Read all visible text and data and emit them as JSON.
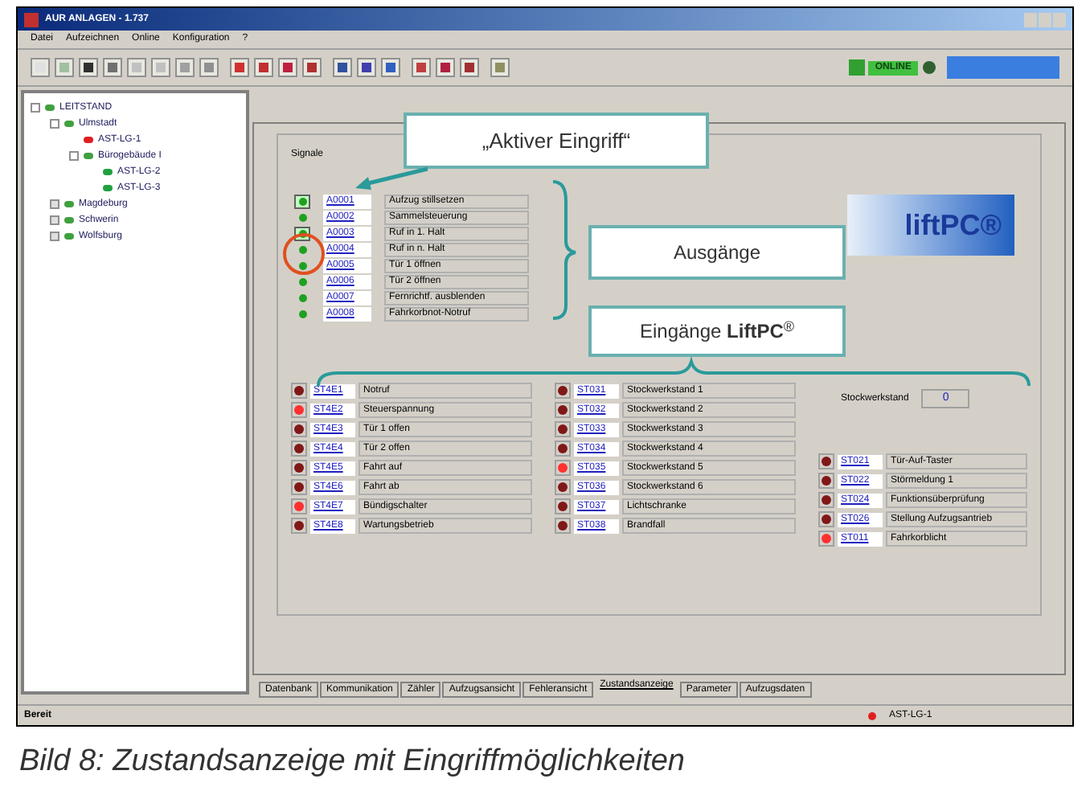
{
  "window": {
    "title": "AUR ANLAGEN - 1.737"
  },
  "menu": [
    "Datei",
    "Aufzeichnen",
    "Online",
    "Konfiguration",
    "?"
  ],
  "toolbar": {
    "status_label": "ONLINE"
  },
  "tree": [
    {
      "label": "LEITSTAND",
      "expanded": true,
      "children": [
        {
          "label": "Ulmstadt",
          "expanded": true,
          "children": [
            {
              "label": "AST-LG-1",
              "color": "#e02020"
            },
            {
              "label": "Bürogebäude I",
              "expanded": true,
              "children": [
                {
                  "label": "AST-LG-2",
                  "color": "#20a040"
                },
                {
                  "label": "AST-LG-3",
                  "color": "#20a040"
                }
              ]
            }
          ]
        },
        {
          "label": "Magdeburg",
          "expanded": false
        },
        {
          "label": "Schwerin",
          "expanded": false
        },
        {
          "label": "Wolfsburg",
          "expanded": false
        }
      ]
    }
  ],
  "signals": {
    "title": "Signale",
    "logo_text": "liftPC®",
    "outputs": [
      {
        "code": "A0001",
        "label": "Aufzug stillsetzen",
        "forced": true,
        "active": true
      },
      {
        "code": "A0002",
        "label": "Sammelsteuerung",
        "forced": false,
        "active": true
      },
      {
        "code": "A0003",
        "label": "Ruf in 1. Halt",
        "forced": true,
        "active": true
      },
      {
        "code": "A0004",
        "label": "Ruf in n. Halt",
        "forced": false,
        "active": true
      },
      {
        "code": "A0005",
        "label": "Tür 1 öffnen",
        "forced": false,
        "active": true
      },
      {
        "code": "A0006",
        "label": "Tür 2 öffnen",
        "forced": false,
        "active": true
      },
      {
        "code": "A0007",
        "label": "Fernrichtf. ausblenden",
        "forced": false,
        "active": true
      },
      {
        "code": "A0008",
        "label": "Fahrkorbnot-Notruf",
        "forced": false,
        "active": true
      }
    ],
    "input_columns": [
      [
        {
          "code": "ST4E1",
          "label": "Notruf",
          "active": false
        },
        {
          "code": "ST4E2",
          "label": "Steuerspannung",
          "active": true
        },
        {
          "code": "ST4E3",
          "label": "Tür 1 offen",
          "active": false
        },
        {
          "code": "ST4E4",
          "label": "Tür 2 offen",
          "active": false
        },
        {
          "code": "ST4E5",
          "label": "Fahrt auf",
          "active": false
        },
        {
          "code": "ST4E6",
          "label": "Fahrt ab",
          "active": false
        },
        {
          "code": "ST4E7",
          "label": "Bündigschalter",
          "active": true
        },
        {
          "code": "ST4E8",
          "label": "Wartungsbetrieb",
          "active": false
        }
      ],
      [
        {
          "code": "ST031",
          "label": "Stockwerkstand 1",
          "active": false
        },
        {
          "code": "ST032",
          "label": "Stockwerkstand 2",
          "active": false
        },
        {
          "code": "ST033",
          "label": "Stockwerkstand 3",
          "active": false
        },
        {
          "code": "ST034",
          "label": "Stockwerkstand 4",
          "active": false
        },
        {
          "code": "ST035",
          "label": "Stockwerkstand 5",
          "active": true
        },
        {
          "code": "ST036",
          "label": "Stockwerkstand 6",
          "active": false
        },
        {
          "code": "ST037",
          "label": "Lichtschranke",
          "active": false
        },
        {
          "code": "ST038",
          "label": "Brandfall",
          "active": false
        }
      ],
      [
        {
          "code": "ST021",
          "label": "Tür-Auf-Taster",
          "active": false
        },
        {
          "code": "ST022",
          "label": "Störmeldung 1",
          "active": false
        },
        {
          "code": "ST024",
          "label": "Funktionsüberprüfung",
          "active": false
        },
        {
          "code": "ST026",
          "label": "Stellung Aufzugsantrieb",
          "active": false
        },
        {
          "code": "ST011",
          "label": "Fahrkorblicht",
          "active": true
        }
      ]
    ],
    "floor": {
      "label": "Stockwerkstand",
      "value": "0"
    }
  },
  "tabs": [
    {
      "label": "Datenbank",
      "selected": false
    },
    {
      "label": "Kommunikation",
      "selected": false
    },
    {
      "label": "Zähler",
      "selected": false
    },
    {
      "label": "Aufzugsansicht",
      "selected": false
    },
    {
      "label": "Fehleransicht",
      "selected": false
    },
    {
      "label": "Zustandsanzeige",
      "selected": true
    },
    {
      "label": "Parameter",
      "selected": false
    },
    {
      "label": "Aufzugsdaten",
      "selected": false
    }
  ],
  "status_bar": {
    "text": "Bereit",
    "device": "AST-LG-1"
  },
  "callouts": [
    {
      "text": "„Aktiver Eingriff“"
    },
    {
      "text": "Ausgänge"
    },
    {
      "text": "Eingänge **LiftPC**$^{®}$"
    }
  ],
  "caption": "Bild 8: Zustandsanzeige mit Eingriffmöglichkeiten"
}
